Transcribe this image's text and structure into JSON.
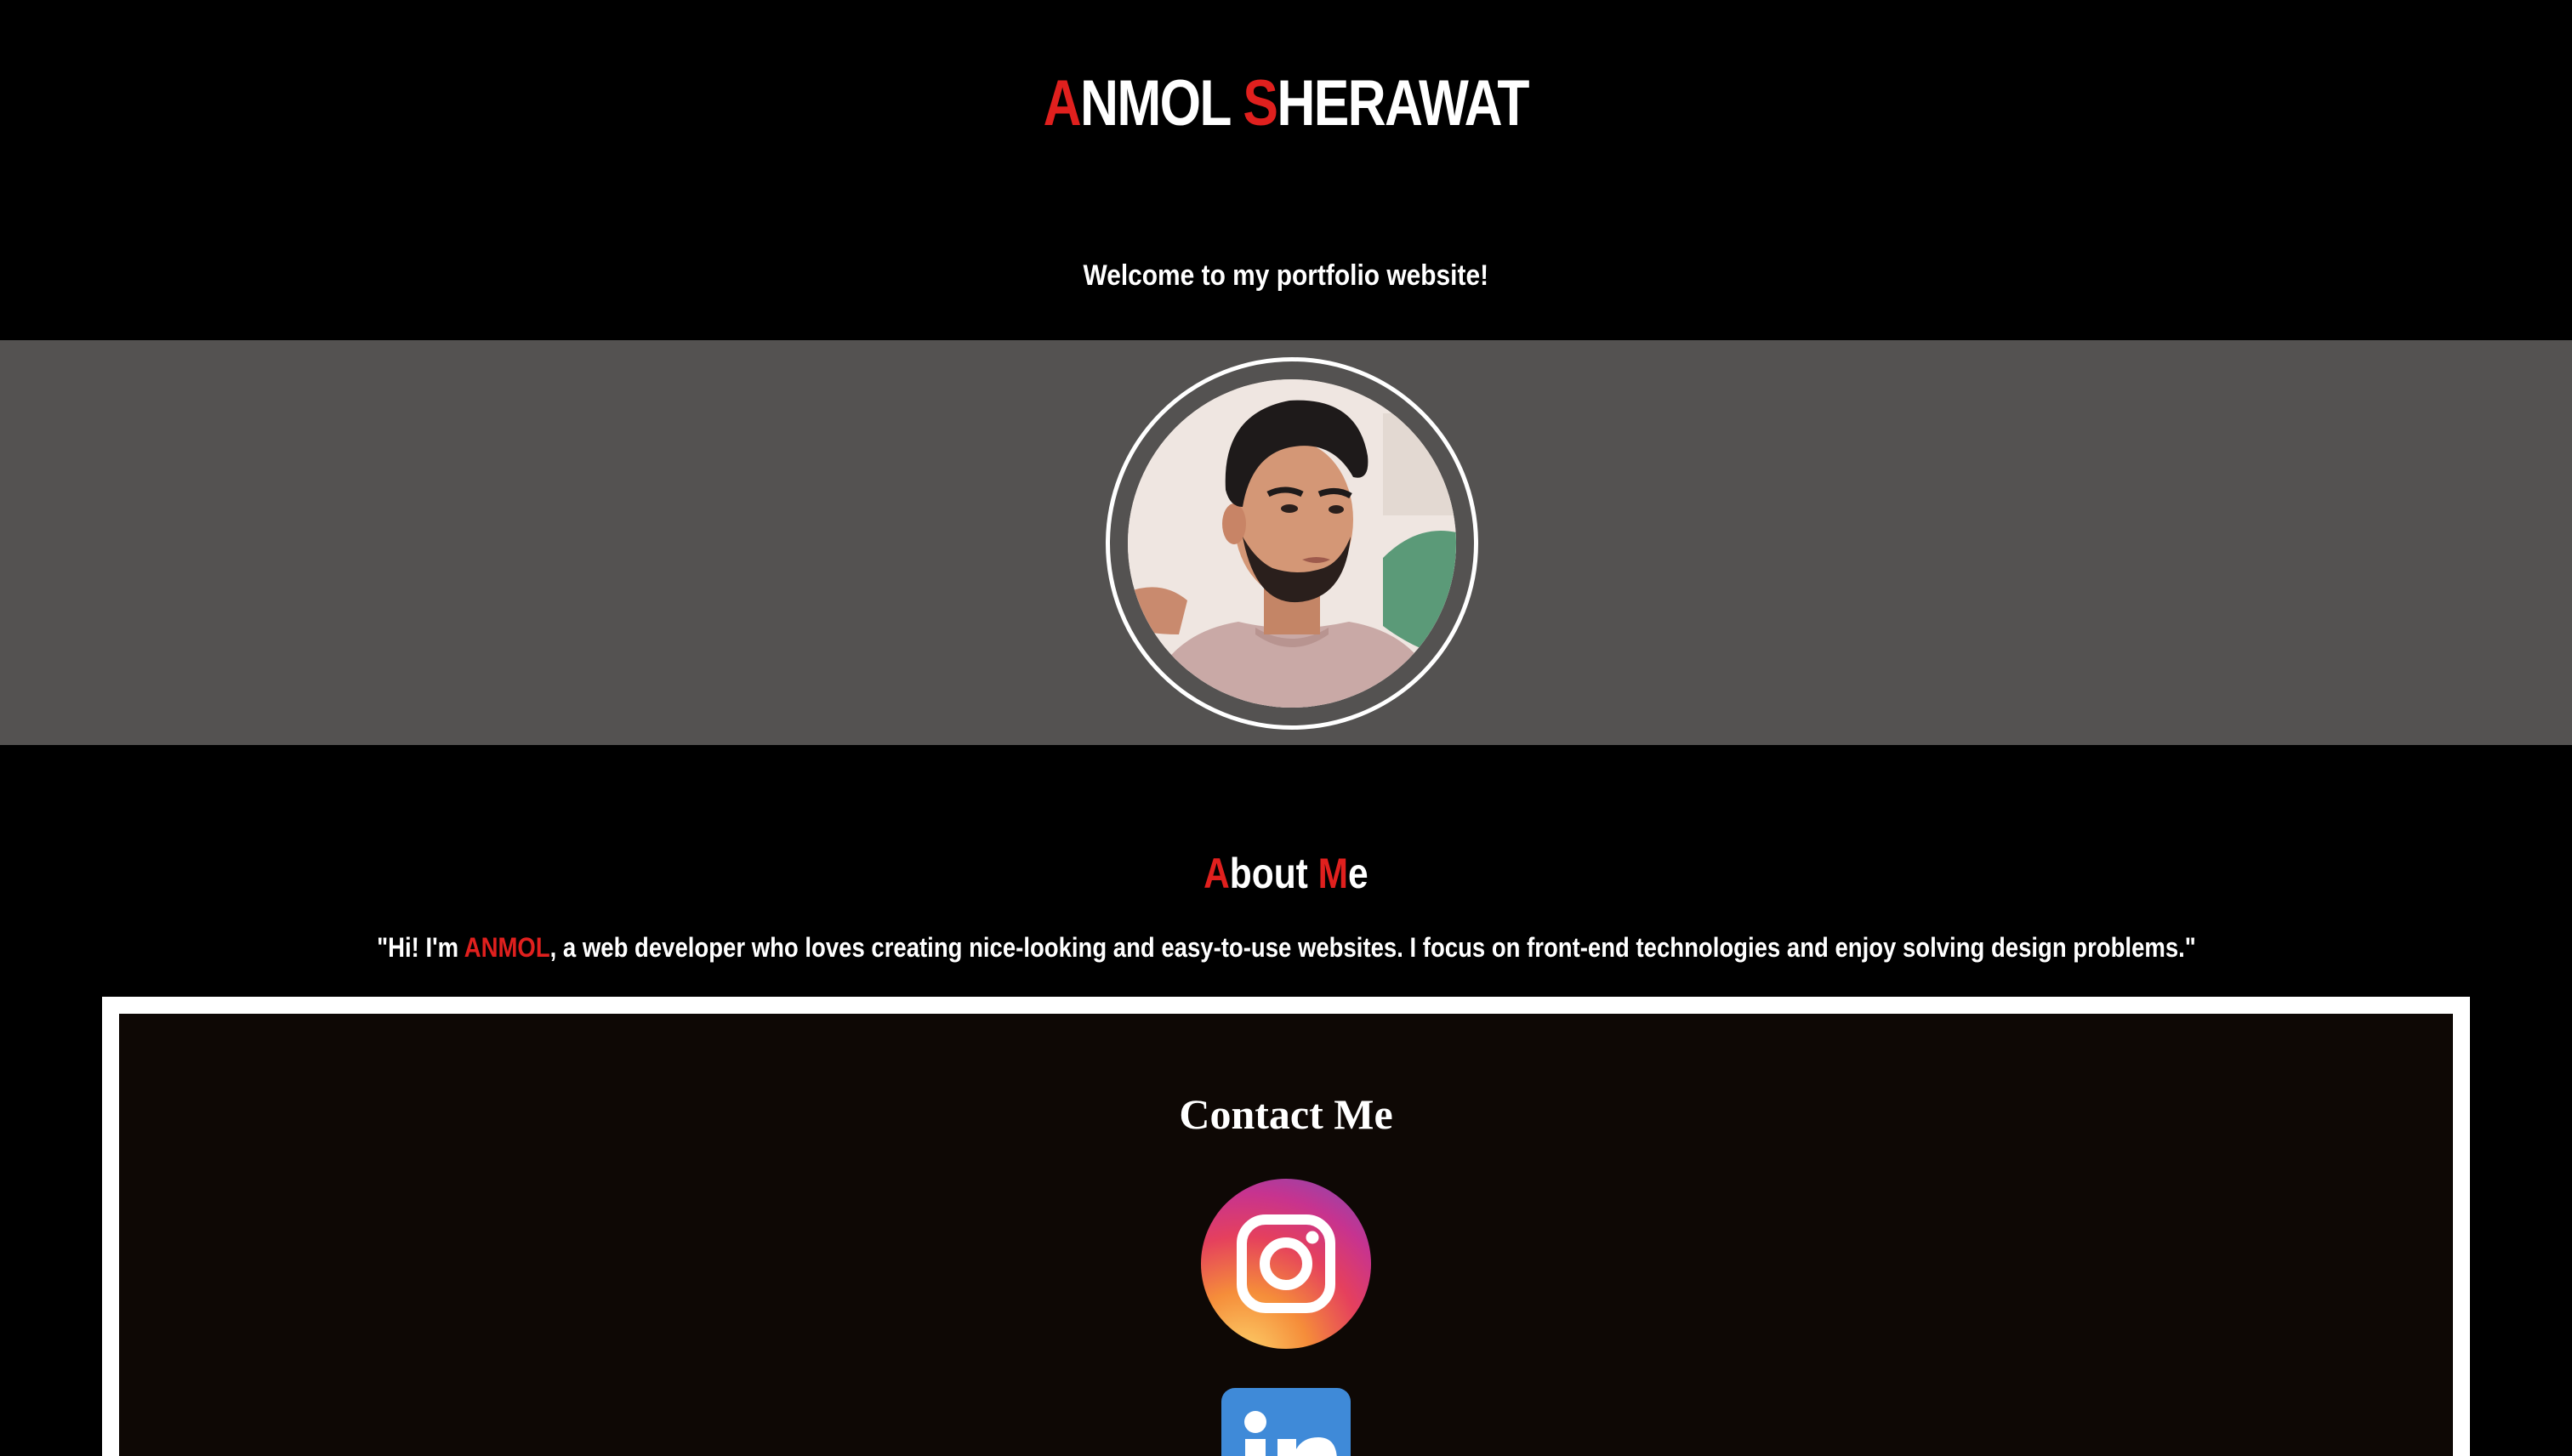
{
  "header": {
    "title_first_initial": "A",
    "title_first_rest": "NMOL",
    "title_last_initial": "S",
    "title_last_rest": "HERAWAT",
    "welcome": "Welcome to my portfolio website!"
  },
  "hero": {
    "avatar_alt": "profile-photo"
  },
  "about": {
    "heading_a_initial": "A",
    "heading_a_rest": "bout",
    "heading_m_initial": "M",
    "heading_m_rest": "e",
    "text_before": "\"Hi! I'm ",
    "text_name": "ANMOL",
    "text_after": ", a web developer who loves creating nice-looking and easy-to-use websites. I focus on front-end technologies and enjoy solving design problems.\""
  },
  "contact": {
    "heading": "Contact Me",
    "links": [
      {
        "icon": "instagram-icon"
      },
      {
        "icon": "linkedin-icon"
      }
    ]
  },
  "colors": {
    "accent": "#e0201e",
    "background": "#000000",
    "hero_band": "#545251",
    "card_background": "#0e0805",
    "linkedin_blue": "#3f8ad8"
  }
}
